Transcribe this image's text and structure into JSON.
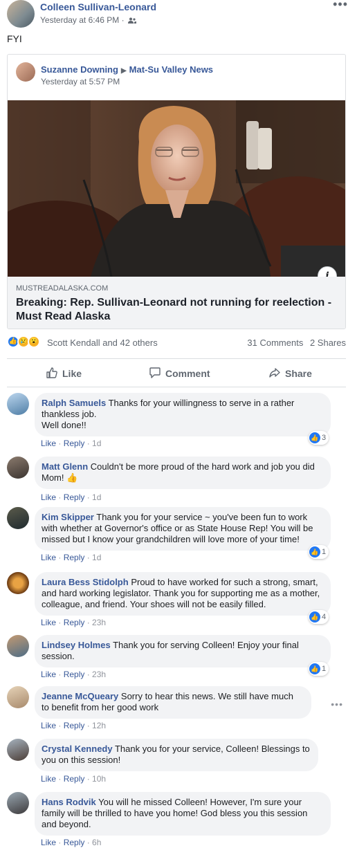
{
  "post": {
    "author": "Colleen Sullivan-Leonard",
    "timestamp": "Yesterday at 6:46 PM",
    "audience_icon": "friends-icon",
    "text": "FYI"
  },
  "shared": {
    "author": "Suzanne Downing",
    "target": "Mat-Su Valley News",
    "timestamp": "Yesterday at 5:57 PM",
    "domain": "MUSTREADALASKA.COM",
    "title": "Breaking: Rep. Sullivan-Leonard not running for reelection - Must Read Alaska"
  },
  "reactions": {
    "icons": [
      "like-icon",
      "sad-icon",
      "wow-icon"
    ],
    "summary": "Scott Kendall and 42 others",
    "comments": "31 Comments",
    "shares": "2 Shares"
  },
  "actions": {
    "like": "Like",
    "comment": "Comment",
    "share": "Share"
  },
  "comment_actions": {
    "like": "Like",
    "reply": "Reply"
  },
  "comments": [
    {
      "name": "Ralph Samuels",
      "text": "Thanks for your willingness to serve in a rather thankless job.\nWell done!!",
      "time": "1d",
      "likes": "3"
    },
    {
      "name": "Matt Glenn",
      "text": "Couldn't be more proud of the hard work and job you did Mom! 👍",
      "time": "1d",
      "likes": ""
    },
    {
      "name": "Kim Skipper",
      "text": "Thank you for your service ~ you've been fun to work with whether at Governor's office or as State House Rep! You will be missed but I know your grandchildren will love more of your time!",
      "time": "1d",
      "likes": "1"
    },
    {
      "name": "Laura Bess Stidolph",
      "text": "Proud to have worked for such a strong, smart, and hard working legislator. Thank you for supporting me as a mother, colleague, and friend. Your shoes will not be easily filled.",
      "time": "23h",
      "likes": "4"
    },
    {
      "name": "Lindsey Holmes",
      "text": "Thank you for serving Colleen! Enjoy your final session.",
      "time": "23h",
      "likes": "1"
    },
    {
      "name": "Jeanne McQueary",
      "text": "Sorry to hear this news. We still have much to benefit from her good work",
      "time": "12h",
      "likes": ""
    },
    {
      "name": "Crystal Kennedy",
      "text": "Thank you for your service, Colleen! Blessings to you on this session!",
      "time": "10h",
      "likes": ""
    },
    {
      "name": "Hans Rodvik",
      "text": "You will he missed Colleen! However, I'm sure your family will be thrilled to have you home! God bless you this session and beyond.",
      "time": "6h",
      "likes": ""
    }
  ]
}
